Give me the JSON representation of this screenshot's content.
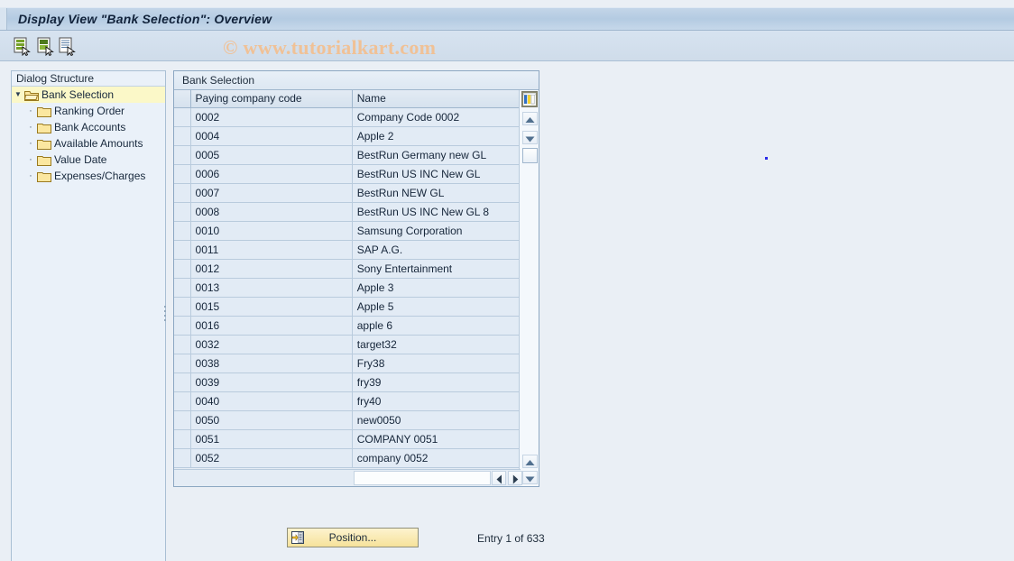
{
  "window": {
    "title": "Display View \"Bank Selection\": Overview"
  },
  "watermark": {
    "text": "© www.tutorialkart.com",
    "color": "#f0c196"
  },
  "toolbar": {
    "buttons": [
      {
        "name": "display-details-icon",
        "tooltip": "Details"
      },
      {
        "name": "select-all-icon",
        "tooltip": "Select"
      },
      {
        "name": "list-entries-icon",
        "tooltip": "List"
      }
    ]
  },
  "tree": {
    "header": "Dialog Structure",
    "items": [
      {
        "label": "Bank Selection",
        "level": 0,
        "expanded": true,
        "selected": true,
        "icon": "open-folder-icon"
      },
      {
        "label": "Ranking Order",
        "level": 1,
        "expanded": false,
        "selected": false,
        "icon": "folder-icon"
      },
      {
        "label": "Bank Accounts",
        "level": 1,
        "expanded": false,
        "selected": false,
        "icon": "folder-icon"
      },
      {
        "label": "Available Amounts",
        "level": 1,
        "expanded": false,
        "selected": false,
        "icon": "folder-icon"
      },
      {
        "label": "Value Date",
        "level": 1,
        "expanded": false,
        "selected": false,
        "icon": "folder-icon"
      },
      {
        "label": "Expenses/Charges",
        "level": 1,
        "expanded": false,
        "selected": false,
        "icon": "folder-icon"
      }
    ]
  },
  "table": {
    "caption": "Bank Selection",
    "columns": [
      "Paying company code",
      "Name"
    ],
    "rows": [
      {
        "code": "0002",
        "name": "Company Code 0002"
      },
      {
        "code": "0004",
        "name": "Apple 2"
      },
      {
        "code": "0005",
        "name": "BestRun Germany new GL"
      },
      {
        "code": "0006",
        "name": "BestRun US INC New GL"
      },
      {
        "code": "0007",
        "name": "BestRun NEW GL"
      },
      {
        "code": "0008",
        "name": "BestRun US INC New GL 8"
      },
      {
        "code": "0010",
        "name": "Samsung Corporation"
      },
      {
        "code": "0011",
        "name": "SAP A.G."
      },
      {
        "code": "0012",
        "name": "Sony Entertainment"
      },
      {
        "code": "0013",
        "name": "Apple 3"
      },
      {
        "code": "0015",
        "name": "Apple 5"
      },
      {
        "code": "0016",
        "name": "apple 6"
      },
      {
        "code": "0032",
        "name": "target32"
      },
      {
        "code": "0038",
        "name": "Fry38"
      },
      {
        "code": "0039",
        "name": "fry39"
      },
      {
        "code": "0040",
        "name": "fry40"
      },
      {
        "code": "0050",
        "name": "new0050"
      },
      {
        "code": "0051",
        "name": "COMPANY 0051"
      },
      {
        "code": "0052",
        "name": "company 0052"
      }
    ]
  },
  "footer": {
    "position_button": "Position...",
    "entry_status": "Entry 1 of 633"
  }
}
